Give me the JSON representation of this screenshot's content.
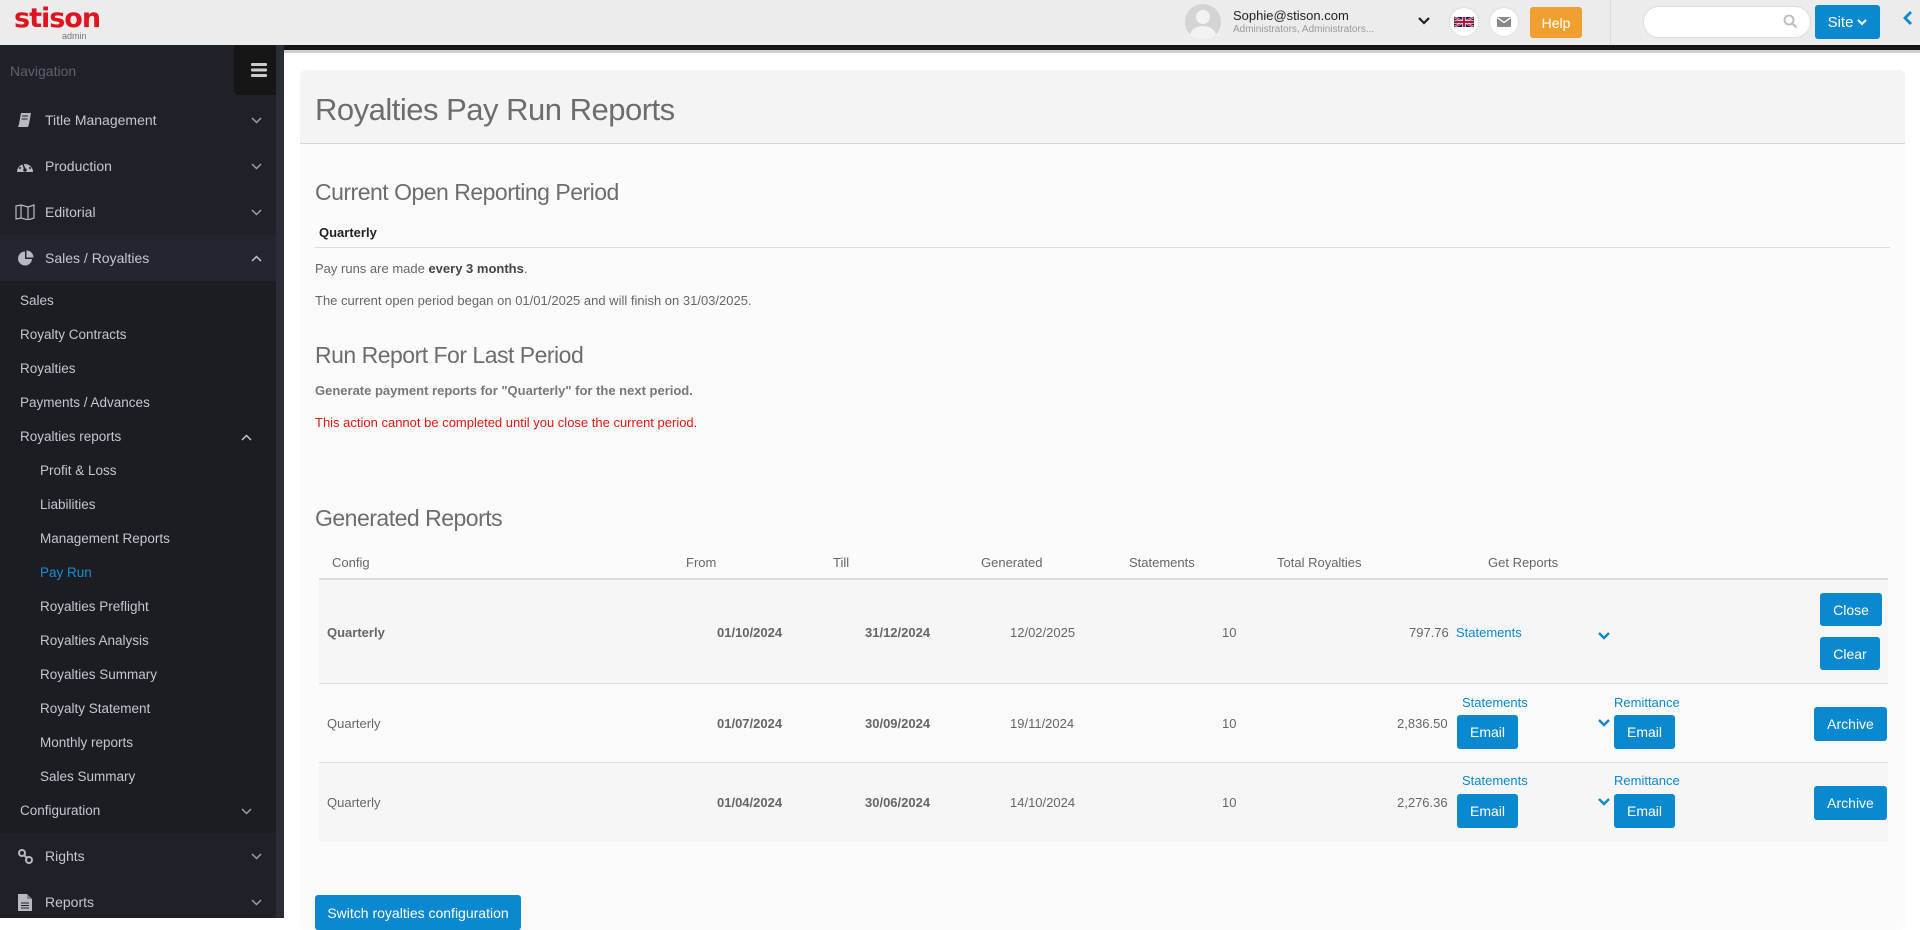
{
  "header": {
    "logo": "stison",
    "logo_sub": "admin",
    "user_email": "Sophie@stison.com",
    "user_roles": "Administrators, Administrators...",
    "help_label": "Help",
    "search_placeholder": "",
    "site_label": "Site",
    "language": "English (UK)"
  },
  "sidebar": {
    "heading": "Navigation",
    "items": [
      {
        "label": "Title Management",
        "icon": "book-icon"
      },
      {
        "label": "Production",
        "icon": "dashboard-icon"
      },
      {
        "label": "Editorial",
        "icon": "map-icon"
      },
      {
        "label": "Sales / Royalties",
        "icon": "pie-chart-icon",
        "expanded": true
      },
      {
        "label": "Rights",
        "icon": "link-icon"
      },
      {
        "label": "Reports",
        "icon": "file-icon"
      }
    ],
    "sales_sub": [
      {
        "label": "Sales"
      },
      {
        "label": "Royalty Contracts"
      },
      {
        "label": "Royalties"
      },
      {
        "label": "Payments / Advances"
      },
      {
        "label": "Royalties reports",
        "expanded": true
      }
    ],
    "reports_sub": [
      {
        "label": "Profit & Loss"
      },
      {
        "label": "Liabilities"
      },
      {
        "label": "Management Reports"
      },
      {
        "label": "Pay Run",
        "active": true
      },
      {
        "label": "Royalties Preflight"
      },
      {
        "label": "Royalties Analysis"
      },
      {
        "label": "Royalties Summary"
      },
      {
        "label": "Royalty Statement"
      },
      {
        "label": "Monthly reports"
      },
      {
        "label": "Sales Summary"
      }
    ],
    "configuration_label": "Configuration"
  },
  "page": {
    "title": "Royalties Pay Run Reports",
    "current_period": {
      "heading": "Current Open Reporting Period",
      "config_name": "Quarterly",
      "line1_prefix": "Pay runs are made ",
      "line1_bold": "every 3 months",
      "line1_suffix": ".",
      "line2": "The current open period began on 01/01/2025 and will finish on 31/03/2025."
    },
    "run_report": {
      "heading": "Run Report For Last Period",
      "generate_text": "Generate payment reports for \"Quarterly\" for the next period.",
      "error_text": "This action cannot be completed until you close the current period."
    },
    "generated": {
      "heading": "Generated Reports",
      "columns": [
        "Config",
        "From",
        "Till",
        "Generated",
        "Statements",
        "Total Royalties",
        "Get Reports"
      ],
      "rows": [
        {
          "config": "Quarterly",
          "from": "01/10/2024",
          "till": "31/12/2024",
          "generated": "12/02/2025",
          "statements": "10",
          "total": "797.76",
          "statements_link": "Statements",
          "actions": [
            "Close",
            "Clear"
          ]
        },
        {
          "config": "Quarterly",
          "from": "01/07/2024",
          "till": "30/09/2024",
          "generated": "19/11/2024",
          "statements": "10",
          "total": "2,836.50",
          "statements_label": "Statements",
          "statements_btn": "Email",
          "remittance_label": "Remittance",
          "remittance_btn": "Email",
          "action": "Archive"
        },
        {
          "config": "Quarterly",
          "from": "01/04/2024",
          "till": "30/06/2024",
          "generated": "14/10/2024",
          "statements": "10",
          "total": "2,276.36",
          "statements_label": "Statements",
          "statements_btn": "Email",
          "remittance_label": "Remittance",
          "remittance_btn": "Email",
          "action": "Archive"
        }
      ]
    },
    "switch_button": "Switch royalties configuration"
  },
  "colors": {
    "brand_red": "#e0141e",
    "primary_blue": "#0a88d0",
    "help_orange": "#f0a030",
    "error_red": "#e8140f",
    "sidebar_bg": "#1e2128"
  }
}
